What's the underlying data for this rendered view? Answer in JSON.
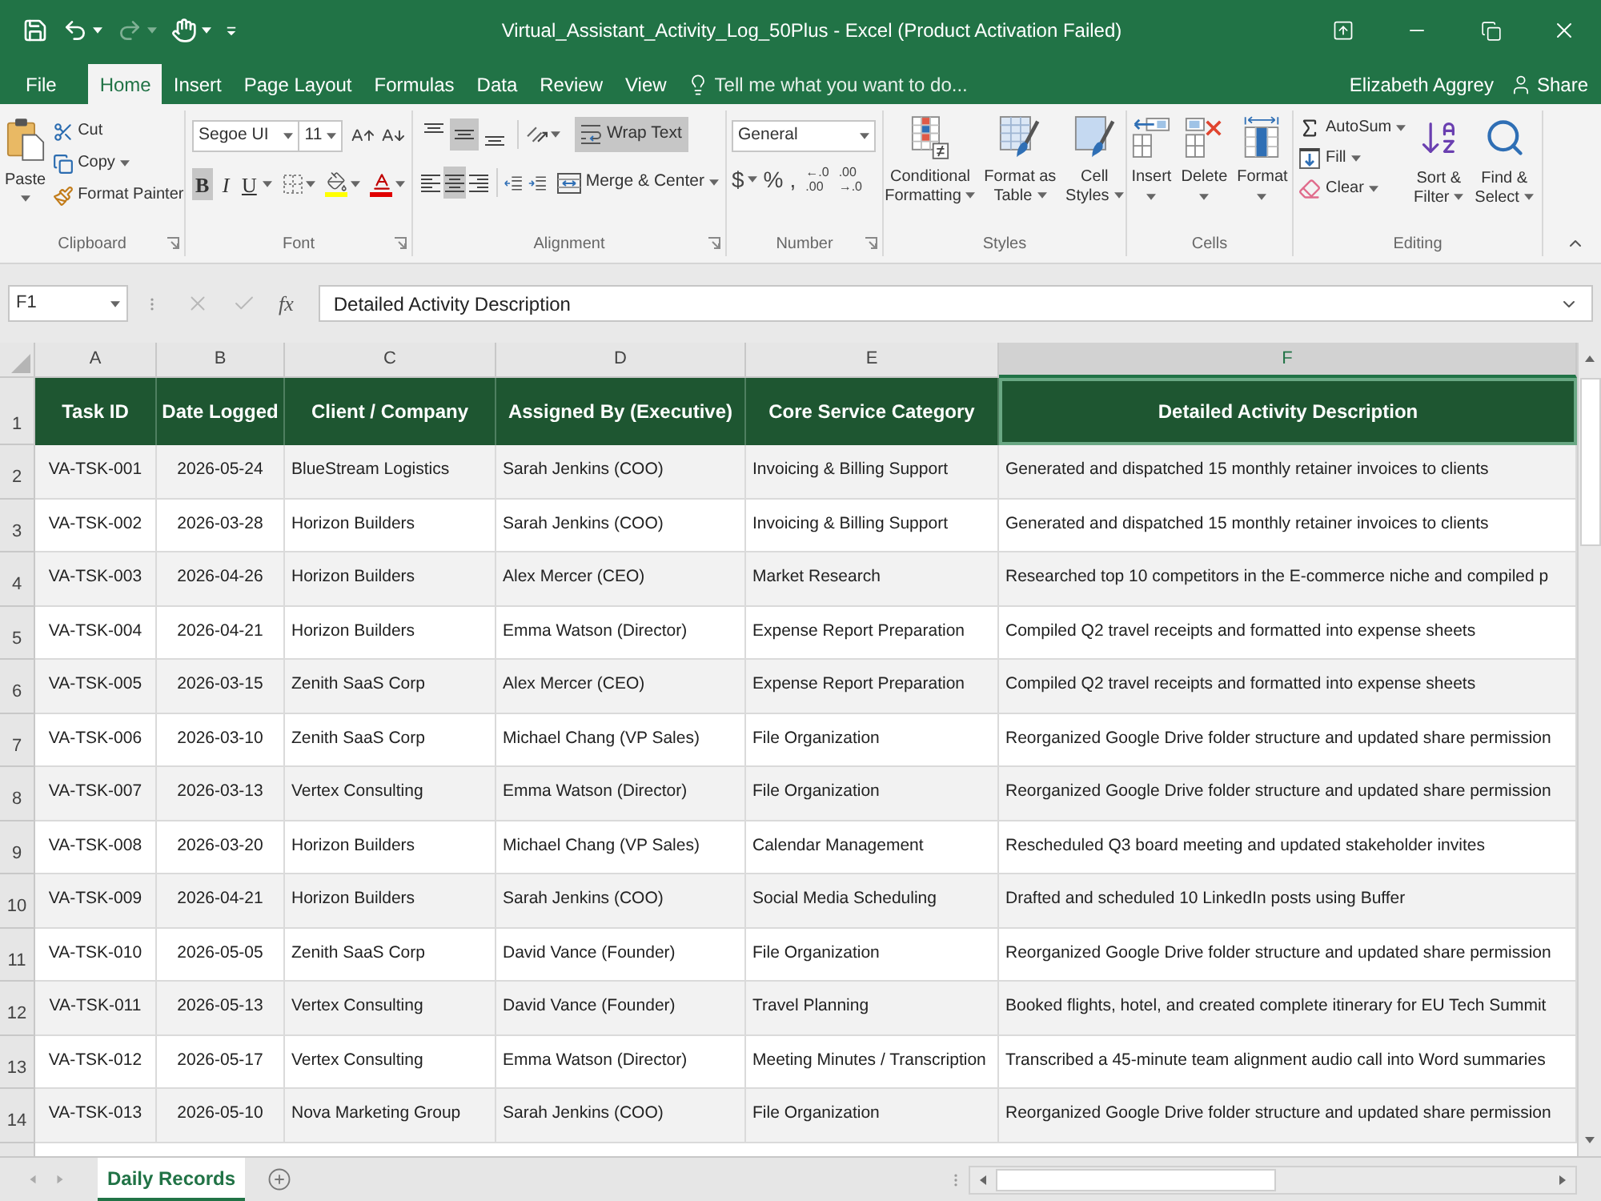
{
  "window": {
    "title": "Virtual_Assistant_Activity_Log_50Plus - Excel (Product Activation Failed)"
  },
  "quick_access": [
    {
      "kind": "save",
      "disabled": false
    },
    {
      "kind": "undo",
      "disabled": false
    },
    {
      "kind": "redo",
      "disabled": true
    },
    {
      "kind": "touch",
      "disabled": false
    }
  ],
  "menu_tabs": [
    {
      "label": "File",
      "selected": false
    },
    {
      "label": "Home",
      "selected": true
    },
    {
      "label": "Insert",
      "selected": false
    },
    {
      "label": "Page Layout",
      "selected": false
    },
    {
      "label": "Formulas",
      "selected": false
    },
    {
      "label": "Data",
      "selected": false
    },
    {
      "label": "Review",
      "selected": false
    },
    {
      "label": "View",
      "selected": false
    }
  ],
  "tell_me": {
    "placeholder": "Tell me what you want to do..."
  },
  "account": {
    "user": "Elizabeth Aggrey",
    "share": "Share"
  },
  "ribbon": {
    "clipboard": {
      "title": "Clipboard",
      "paste": "Paste",
      "cut": "Cut",
      "copy": "Copy",
      "format_painter": "Format Painter"
    },
    "font": {
      "title": "Font",
      "font_name": "Segoe UI",
      "font_size": "11",
      "styles": [
        {
          "label": "B",
          "selected": true
        },
        {
          "label": "I",
          "selected": false
        },
        {
          "label": "U",
          "selected": false
        }
      ]
    },
    "alignment": {
      "title": "Alignment",
      "vertical": [
        {
          "kind": "top",
          "selected": false
        },
        {
          "kind": "middle",
          "selected": true
        },
        {
          "kind": "bottom",
          "selected": false
        }
      ],
      "horizontal": [
        {
          "kind": "left",
          "selected": false
        },
        {
          "kind": "center",
          "selected": true
        },
        {
          "kind": "right",
          "selected": false
        }
      ],
      "wrap_text": {
        "label": "Wrap Text",
        "selected": true
      },
      "merge_center": "Merge & Center"
    },
    "number": {
      "title": "Number",
      "format": "General",
      "symbols": [
        {
          "label": "$",
          "dropdown": true
        },
        {
          "label": "%",
          "dropdown": false
        },
        {
          "label": ",",
          "dropdown": false
        }
      ],
      "decimals": [
        {
          "top": "←.0",
          "bottom": ".00"
        },
        {
          "top": ".00",
          "bottom": "→.0"
        }
      ]
    },
    "styles": {
      "title": "Styles",
      "buttons": [
        {
          "kind": "conditional",
          "label": "Conditional Formatting"
        },
        {
          "kind": "table",
          "label": "Format as Table"
        },
        {
          "kind": "cell_styles",
          "label": "Cell Styles"
        }
      ]
    },
    "cells": {
      "title": "Cells",
      "buttons": [
        {
          "kind": "insert",
          "label": "Insert"
        },
        {
          "kind": "delete",
          "label": "Delete"
        },
        {
          "kind": "format",
          "label": "Format"
        }
      ]
    },
    "editing": {
      "title": "Editing",
      "autosum": "AutoSum",
      "fill": "Fill",
      "clear": "Clear",
      "sort_filter": "Sort & Filter",
      "find_select": "Find & Select"
    }
  },
  "formula_bar": {
    "name_box": "F1",
    "buttons": [
      {
        "kind": "cancel",
        "disabled": true
      },
      {
        "kind": "enter",
        "disabled": true
      }
    ],
    "function_label": "fx",
    "value": "Detailed Activity Description"
  },
  "sheet": {
    "columns": [
      {
        "letter": "A",
        "header": "Task ID",
        "selected": false
      },
      {
        "letter": "B",
        "header": "Date Logged",
        "selected": false
      },
      {
        "letter": "C",
        "header": "Client / Company",
        "selected": false
      },
      {
        "letter": "D",
        "header": "Assigned By (Executive)",
        "selected": false
      },
      {
        "letter": "E",
        "header": "Core Service Category",
        "selected": false
      },
      {
        "letter": "F",
        "header": "Detailed Activity Description",
        "selected": true
      }
    ],
    "header_row_number": "1",
    "rows": [
      {
        "number": "2",
        "cells": [
          "VA-TSK-001",
          "2026-05-24",
          "BlueStream Logistics",
          "Sarah Jenkins (COO)",
          "Invoicing & Billing Support",
          "Generated and dispatched 15 monthly retainer invoices to clients"
        ]
      },
      {
        "number": "3",
        "cells": [
          "VA-TSK-002",
          "2026-03-28",
          "Horizon Builders",
          "Sarah Jenkins (COO)",
          "Invoicing & Billing Support",
          "Generated and dispatched 15 monthly retainer invoices to clients"
        ]
      },
      {
        "number": "4",
        "cells": [
          "VA-TSK-003",
          "2026-04-26",
          "Horizon Builders",
          "Alex Mercer (CEO)",
          "Market Research",
          "Researched top 10 competitors in the E-commerce niche and compiled p"
        ]
      },
      {
        "number": "5",
        "cells": [
          "VA-TSK-004",
          "2026-04-21",
          "Horizon Builders",
          "Emma Watson (Director)",
          "Expense Report Preparation",
          "Compiled Q2 travel receipts and formatted into expense sheets"
        ]
      },
      {
        "number": "6",
        "cells": [
          "VA-TSK-005",
          "2026-03-15",
          "Zenith SaaS Corp",
          "Alex Mercer (CEO)",
          "Expense Report Preparation",
          "Compiled Q2 travel receipts and formatted into expense sheets"
        ]
      },
      {
        "number": "7",
        "cells": [
          "VA-TSK-006",
          "2026-03-10",
          "Zenith SaaS Corp",
          "Michael Chang (VP Sales)",
          "File Organization",
          "Reorganized Google Drive folder structure and updated share permission"
        ]
      },
      {
        "number": "8",
        "cells": [
          "VA-TSK-007",
          "2026-03-13",
          "Vertex Consulting",
          "Emma Watson (Director)",
          "File Organization",
          "Reorganized Google Drive folder structure and updated share permission"
        ]
      },
      {
        "number": "9",
        "cells": [
          "VA-TSK-008",
          "2026-03-20",
          "Horizon Builders",
          "Michael Chang (VP Sales)",
          "Calendar Management",
          "Rescheduled Q3 board meeting and updated stakeholder invites"
        ]
      },
      {
        "number": "10",
        "cells": [
          "VA-TSK-009",
          "2026-04-21",
          "Horizon Builders",
          "Sarah Jenkins (COO)",
          "Social Media Scheduling",
          "Drafted and scheduled 10 LinkedIn posts using Buffer"
        ]
      },
      {
        "number": "11",
        "cells": [
          "VA-TSK-010",
          "2026-05-05",
          "Zenith SaaS Corp",
          "David Vance (Founder)",
          "File Organization",
          "Reorganized Google Drive folder structure and updated share permission"
        ]
      },
      {
        "number": "12",
        "cells": [
          "VA-TSK-011",
          "2026-05-13",
          "Vertex Consulting",
          "David Vance (Founder)",
          "Travel Planning",
          "Booked flights, hotel, and created complete itinerary for EU Tech Summit"
        ]
      },
      {
        "number": "13",
        "cells": [
          "VA-TSK-012",
          "2026-05-17",
          "Vertex Consulting",
          "Emma Watson (Director)",
          "Meeting Minutes / Transcription",
          "Transcribed a 45-minute team alignment audio call into Word summaries"
        ]
      },
      {
        "number": "14",
        "cells": [
          "VA-TSK-013",
          "2026-05-10",
          "Nova Marketing Group",
          "Sarah Jenkins (COO)",
          "File Organization",
          "Reorganized Google Drive folder structure and updated share permission"
        ]
      }
    ]
  },
  "sheet_tabs": [
    {
      "label": "Daily Records",
      "selected": true
    }
  ]
}
